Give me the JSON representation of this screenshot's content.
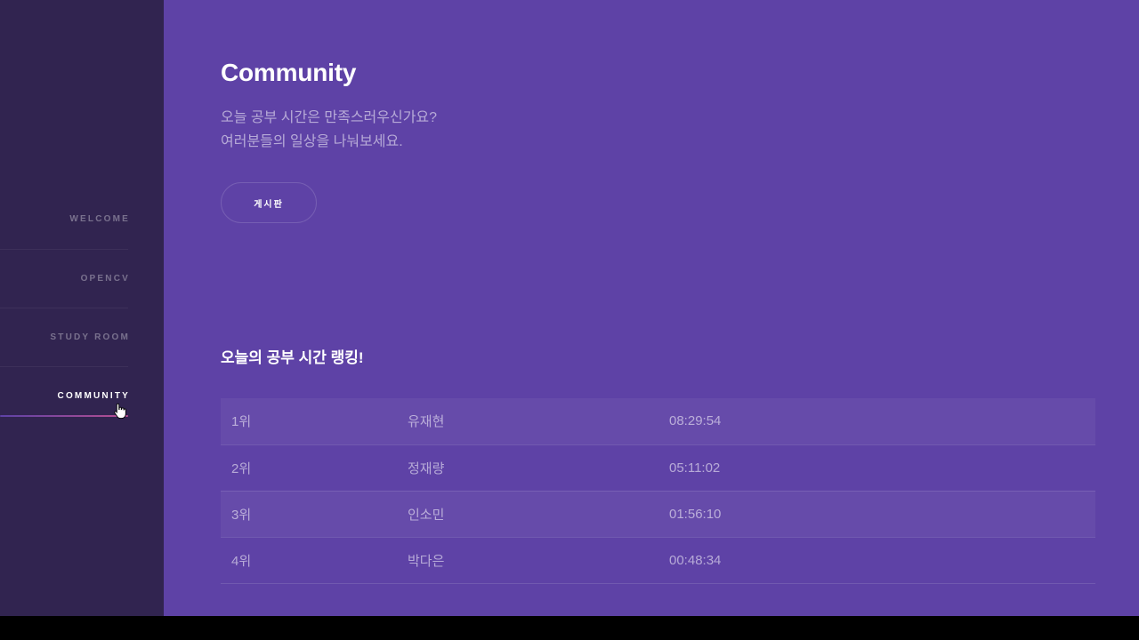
{
  "sidebar": {
    "items": [
      {
        "label": "WELCOME",
        "active": false
      },
      {
        "label": "OPENCV",
        "active": false
      },
      {
        "label": "STUDY ROOM",
        "active": false
      },
      {
        "label": "COMMUNITY",
        "active": true
      }
    ]
  },
  "main": {
    "title": "Community",
    "intro_line1": "오늘 공부 시간은 만족스러우신가요?",
    "intro_line2": "여러분들의 일상을 나눠보세요.",
    "board_button_label": "게시판",
    "ranking_title": "오늘의 공부 시간 랭킹!",
    "ranking": [
      {
        "rank": "1위",
        "name": "유재현",
        "time": "08:29:54"
      },
      {
        "rank": "2위",
        "name": "정재량",
        "time": "05:11:02"
      },
      {
        "rank": "3위",
        "name": "인소민",
        "time": "01:56:10"
      },
      {
        "rank": "4위",
        "name": "박다은",
        "time": "00:48:34"
      }
    ]
  },
  "colors": {
    "sidebar_bg": "#312450",
    "main_bg": "#5e42a6",
    "accent_gradient_start": "#5e42a6",
    "accent_gradient_end": "#b74e91"
  },
  "icons": {
    "cursor": "hand-pointer-icon"
  }
}
